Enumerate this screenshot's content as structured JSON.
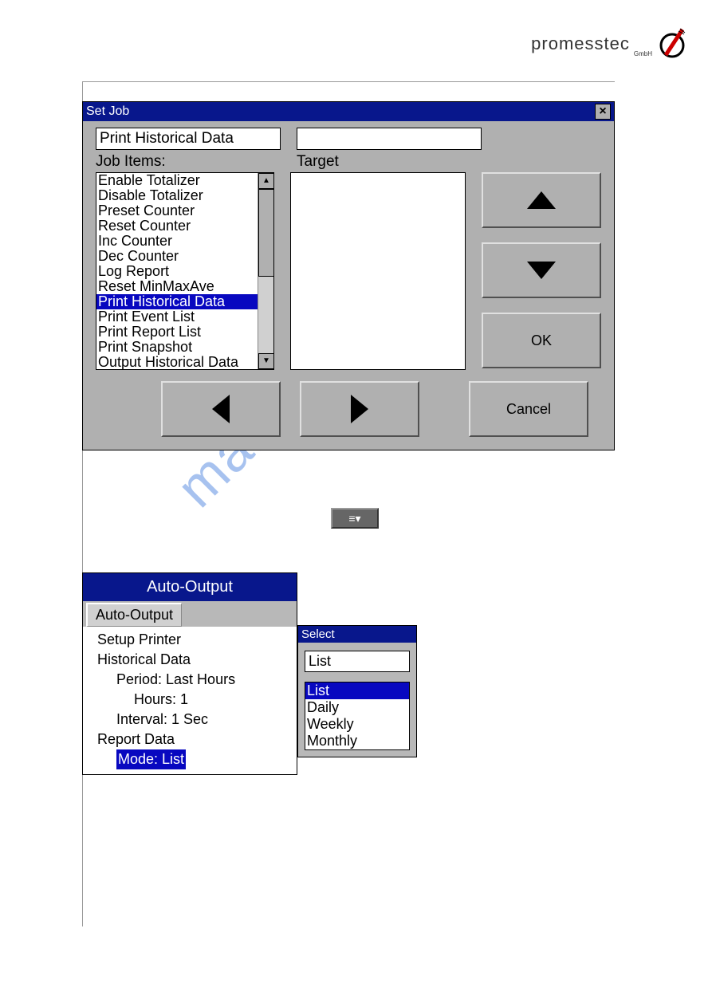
{
  "logo": {
    "text": "promesstec",
    "sub": "GmbH"
  },
  "set_job": {
    "title": "Set Job",
    "close_glyph": "×",
    "job_name": "Print Historical Data",
    "target_value": "",
    "labels": {
      "job_items": "Job Items:",
      "target": "Target"
    },
    "items": [
      "Enable Totalizer",
      "Disable Totalizer",
      "Preset Counter",
      "Reset Counter",
      "Inc Counter",
      "Dec Counter",
      "Log Report",
      "Reset MinMaxAve",
      "Print Historical Data",
      "Print Event List",
      "Print Report List",
      "Print Snapshot",
      "Output Historical Data"
    ],
    "selected_index": 8,
    "buttons": {
      "ok": "OK",
      "cancel": "Cancel"
    }
  },
  "center_btn": {
    "glyph": "≡▾"
  },
  "auto_output": {
    "title": "Auto-Output",
    "tab": "Auto-Output",
    "tree": [
      {
        "level": 1,
        "text": "Setup Printer"
      },
      {
        "level": 1,
        "text": "Historical Data"
      },
      {
        "level": 2,
        "text": "Period: Last Hours"
      },
      {
        "level": 3,
        "text": "Hours: 1"
      },
      {
        "level": 2,
        "text": "Interval: 1 Sec"
      },
      {
        "level": 1,
        "text": "Report Data"
      },
      {
        "level": 2,
        "text": "Mode: List",
        "selected": true
      }
    ]
  },
  "select": {
    "title": "Select",
    "value": "List",
    "options": [
      "List",
      "Daily",
      "Weekly",
      "Monthly"
    ],
    "selected_index": 0
  },
  "watermark": "manualshive.com"
}
